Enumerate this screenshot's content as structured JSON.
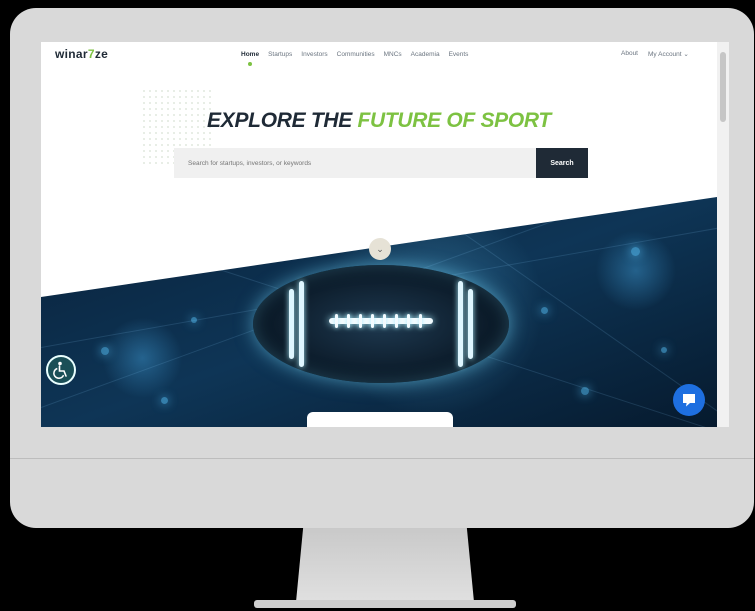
{
  "nav": {
    "logo_text_a": "winar",
    "logo_text_seven": "7",
    "logo_text_b": "ze",
    "items": [
      {
        "label": "Home",
        "active": true
      },
      {
        "label": "Startups"
      },
      {
        "label": "Investors"
      },
      {
        "label": "Communities"
      },
      {
        "label": "MNCs"
      },
      {
        "label": "Academia"
      },
      {
        "label": "Events"
      }
    ],
    "about_label": "About",
    "account_label": "My Account",
    "account_caret": "⌄"
  },
  "hero": {
    "title_part1": "EXPLORE THE ",
    "title_part2": "FUTURE OF SPORT"
  },
  "search": {
    "placeholder": "Search for startups, investors, or keywords",
    "button_label": "Search"
  },
  "icons": {
    "scroll_down": "chevron-down-icon",
    "accessibility": "accessibility-icon",
    "chat": "chat-icon"
  },
  "colors": {
    "brand_dark": "#1f2a36",
    "brand_green": "#7dc242",
    "chat_blue": "#1e6fe0",
    "accessibility_teal": "#1a4f57"
  }
}
